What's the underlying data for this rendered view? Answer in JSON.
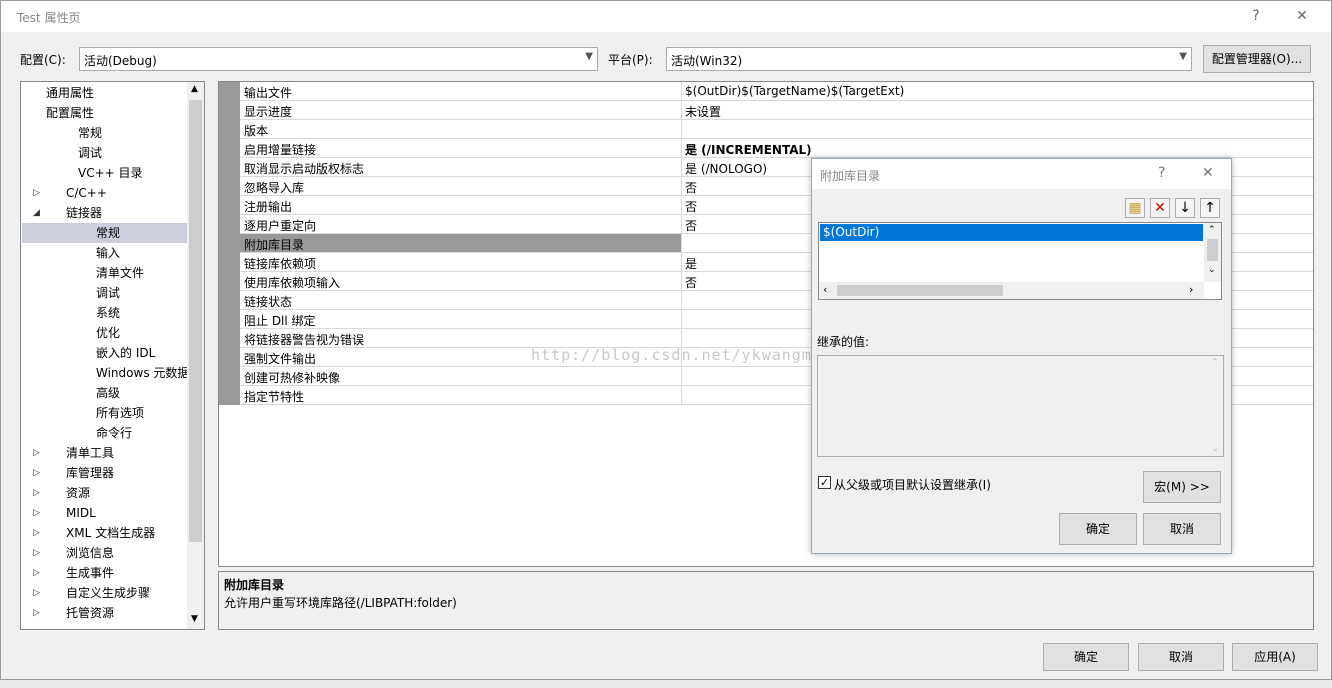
{
  "window": {
    "title": "Test 属性页",
    "help_glyph": "?",
    "close_glyph": "✕"
  },
  "config": {
    "label": "配置(C):",
    "value": "活动(Debug)",
    "platform_label": "平台(P):",
    "platform_value": "活动(Win32)",
    "manager_button": "配置管理器(O)..."
  },
  "tree": {
    "items": [
      {
        "label": "通用属性",
        "caret": "▷"
      },
      {
        "label": "配置属性",
        "caret": "◢"
      },
      {
        "label": "常规",
        "caret": ""
      },
      {
        "label": "调试",
        "caret": ""
      },
      {
        "label": "VC++ 目录",
        "caret": ""
      },
      {
        "label": "C/C++",
        "caret": "▷"
      },
      {
        "label": "链接器",
        "caret": "◢"
      },
      {
        "label": "常规",
        "caret": ""
      },
      {
        "label": "输入",
        "caret": ""
      },
      {
        "label": "清单文件",
        "caret": ""
      },
      {
        "label": "调试",
        "caret": ""
      },
      {
        "label": "系统",
        "caret": ""
      },
      {
        "label": "优化",
        "caret": ""
      },
      {
        "label": "嵌入的 IDL",
        "caret": ""
      },
      {
        "label": "Windows 元数据",
        "caret": ""
      },
      {
        "label": "高级",
        "caret": ""
      },
      {
        "label": "所有选项",
        "caret": ""
      },
      {
        "label": "命令行",
        "caret": ""
      },
      {
        "label": "清单工具",
        "caret": "▷"
      },
      {
        "label": "库管理器",
        "caret": "▷"
      },
      {
        "label": "资源",
        "caret": "▷"
      },
      {
        "label": "MIDL",
        "caret": "▷"
      },
      {
        "label": "XML 文档生成器",
        "caret": "▷"
      },
      {
        "label": "浏览信息",
        "caret": "▷"
      },
      {
        "label": "生成事件",
        "caret": "▷"
      },
      {
        "label": "自定义生成步骤",
        "caret": "▷"
      },
      {
        "label": "托管资源",
        "caret": "▷"
      }
    ]
  },
  "grid": {
    "rows": [
      {
        "name": "输出文件",
        "value": "$(OutDir)$(TargetName)$(TargetExt)"
      },
      {
        "name": "显示进度",
        "value": "未设置"
      },
      {
        "name": "版本",
        "value": ""
      },
      {
        "name": "启用增量链接",
        "value": "是 (/INCREMENTAL)"
      },
      {
        "name": "取消显示启动版权标志",
        "value": "是 (/NOLOGO)"
      },
      {
        "name": "忽略导入库",
        "value": "否"
      },
      {
        "name": "注册输出",
        "value": "否"
      },
      {
        "name": "逐用户重定向",
        "value": "否"
      },
      {
        "name": "附加库目录",
        "value": ""
      },
      {
        "name": "链接库依赖项",
        "value": "是"
      },
      {
        "name": "使用库依赖项输入",
        "value": "否"
      },
      {
        "name": "链接状态",
        "value": ""
      },
      {
        "name": "阻止 Dll 绑定",
        "value": ""
      },
      {
        "name": "将链接器警告视为错误",
        "value": ""
      },
      {
        "name": "强制文件输出",
        "value": ""
      },
      {
        "name": "创建可热修补映像",
        "value": ""
      },
      {
        "name": "指定节特性",
        "value": ""
      }
    ]
  },
  "description": {
    "title": "附加库目录",
    "text": "允许用户重写环境库路径(/LIBPATH:folder)"
  },
  "watermark": "http://blog.csdn.net/ykwangm",
  "dialog": {
    "title": "附加库目录",
    "help_glyph": "?",
    "close_glyph": "✕",
    "list_items": [
      "$(OutDir)"
    ],
    "inherited_label": "继承的值:",
    "inherit_checkbox_label": "从父级或项目默认设置继承(I)",
    "macro_button": "宏(M) >>",
    "ok_button": "确定",
    "cancel_button": "取消"
  },
  "footer": {
    "ok": "确定",
    "cancel": "取消",
    "apply": "应用(A)"
  }
}
